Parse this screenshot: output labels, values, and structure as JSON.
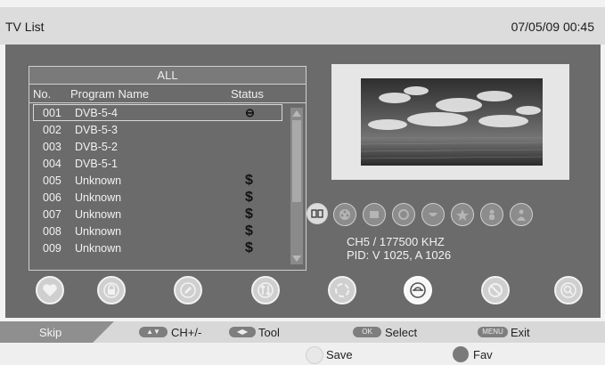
{
  "header": {
    "title": "TV List",
    "datetime": "07/05/09 00:45"
  },
  "list": {
    "group": "ALL",
    "columns": {
      "no": "No.",
      "name": "Program Name",
      "status": "Status"
    },
    "rows": [
      {
        "no": "001",
        "name": "DVB-5-4",
        "status": "⊖"
      },
      {
        "no": "002",
        "name": "DVB-5-3",
        "status": ""
      },
      {
        "no": "003",
        "name": "DVB-5-2",
        "status": ""
      },
      {
        "no": "004",
        "name": "DVB-5-1",
        "status": ""
      },
      {
        "no": "005",
        "name": "Unknown",
        "status": "$"
      },
      {
        "no": "006",
        "name": "Unknown",
        "status": "$"
      },
      {
        "no": "007",
        "name": "Unknown",
        "status": "$"
      },
      {
        "no": "008",
        "name": "Unknown",
        "status": "$"
      },
      {
        "no": "009",
        "name": "Unknown",
        "status": "$"
      }
    ]
  },
  "channel_info": {
    "line1": "CH5 / 177500  KHZ",
    "line2": "PID: V 1025, A 1026"
  },
  "footer": {
    "skip": "Skip",
    "ch_label": "CH+/-",
    "tool_label": "Tool",
    "ok_key": "OK",
    "select_label": "Select",
    "menu_key": "MENU",
    "exit_label": "Exit",
    "save_label": "Save",
    "fav_label": "Fav"
  },
  "colors": {
    "panel": "#6b6b6b",
    "save_dot": "#e8e8e8",
    "fav_dot": "#7a7a7a"
  }
}
